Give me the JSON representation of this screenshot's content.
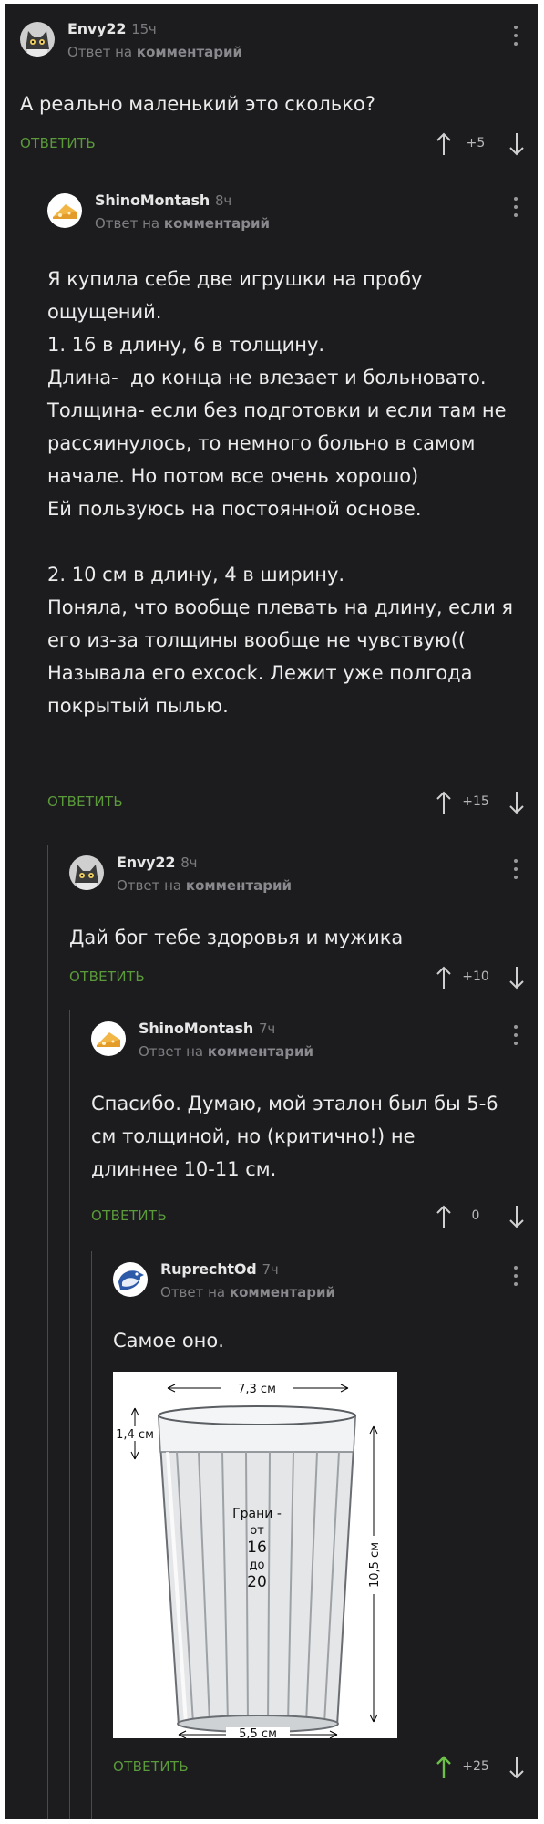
{
  "ui": {
    "reply_label": "ОТВЕТИТЬ",
    "reply_to_prefix": "Ответ на",
    "reply_to_target": "комментарий"
  },
  "comments": [
    {
      "username": "Envy22",
      "time": "15ч",
      "text": "А реально маленький это сколько?",
      "votes": "+5",
      "avatar": "cat-avatar"
    },
    {
      "username": "ShinoMontash",
      "time": "8ч",
      "paragraphs": [
        "Я купила себе две игрушки на пробу ощущений.",
        "1. 16 в длину, 6 в толщину.",
        "Длина-  до конца не влезает и больновато.",
        "Толщина- если без подготовки и если там не рассяинулось, то немного больно в самом начале. Но потом все очень хорошо)",
        "Ей пользуюсь на постоянной основе.",
        "",
        "2. 10 см в длину, 4 в ширину.",
        "Поняла, что вообще плевать на длину, если я его из-за толщины вообще не чувствую((",
        "Называла его excock. Лежит уже полгода покрытый пылью."
      ],
      "votes": "+15",
      "avatar": "cheese-avatar"
    },
    {
      "username": "Envy22",
      "time": "8ч",
      "text": "Дай бог тебе здоровья и мужика",
      "votes": "+10",
      "avatar": "cat-avatar"
    },
    {
      "username": "ShinoMontash",
      "time": "7ч",
      "text": "Спасибо. Думаю, мой эталон был бы 5-6 см толщиной, но (критично!) не длиннее 10-11 см.",
      "votes": "0",
      "avatar": "cheese-avatar"
    },
    {
      "username": "RuprechtOd",
      "time": "7ч",
      "text": "Самое оно.",
      "votes": "+25",
      "avatar": "bird-avatar",
      "image": {
        "top_width": "7,3 см",
        "rim_height": "1,4 см",
        "facets_line1": "Грани -",
        "facets_line2": "от",
        "facets_line3": "16",
        "facets_line4": "до",
        "facets_line5": "20",
        "height": "10,5 см",
        "bottom_width": "5,5 см"
      }
    }
  ],
  "colors": {
    "background": "#1c1c1e",
    "reply_green": "#5a9a3a",
    "upvote_green": "#6cc04a",
    "text": "#ececec"
  }
}
